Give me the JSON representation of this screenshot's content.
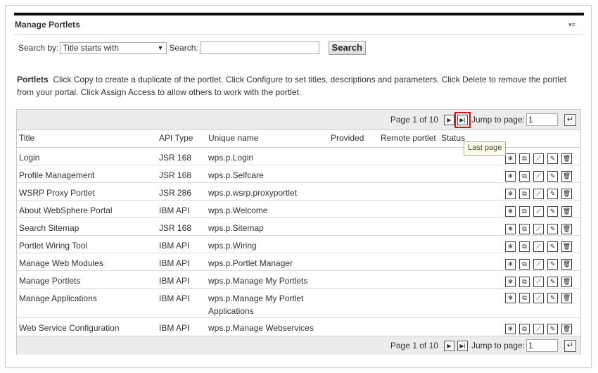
{
  "portlet": {
    "title": "Manage Portlets"
  },
  "search": {
    "by_label": "Search by:",
    "by_value": "Title starts with",
    "label": "Search:",
    "value": "",
    "button": "Search"
  },
  "description": {
    "heading": "Portlets",
    "text": "Click Copy to create a duplicate of the portlet. Click Configure to set titles, descriptions and parameters. Click Delete to remove the portlet from your portal. Click Assign Access to allow others to work with the portlet."
  },
  "pager": {
    "page_text": "Page 1 of 10",
    "jump_label": "Jump to page:",
    "jump_value": "1",
    "tooltip": "Last page"
  },
  "table": {
    "columns": [
      "Title",
      "API Type",
      "Unique name",
      "Provided",
      "Remote portlet",
      "Status"
    ],
    "rows": [
      {
        "title": "Login",
        "api": "JSR 168",
        "unique": "wps.p.Login",
        "unique2": ""
      },
      {
        "title": "Profile Management",
        "api": "JSR 168",
        "unique": "wps.p.Selfcare",
        "unique2": ""
      },
      {
        "title": "WSRP Proxy Portlet",
        "api": "JSR 286",
        "unique": "wps.p.wsrp.proxyportlet",
        "unique2": ""
      },
      {
        "title": "About WebSphere Portal",
        "api": "IBM API",
        "unique": "wps.p.Welcome",
        "unique2": ""
      },
      {
        "title": "Search Sitemap",
        "api": "JSR 168",
        "unique": "wps.p.Sitemap",
        "unique2": ""
      },
      {
        "title": "Portlet Wiring Tool",
        "api": "IBM API",
        "unique": "wps.p.Wiring",
        "unique2": ""
      },
      {
        "title": "Manage Web Modules",
        "api": "IBM API",
        "unique": "wps.p.Portlet Manager",
        "unique2": ""
      },
      {
        "title": "Manage Portlets",
        "api": "IBM API",
        "unique": "wps.p.Manage My Portlets",
        "unique2": ""
      },
      {
        "title": "Manage Applications",
        "api": "IBM API",
        "unique": "wps.p.Manage My Portlet",
        "unique2": "Applications"
      },
      {
        "title": "Web Service Configuration",
        "api": "IBM API",
        "unique": "wps.p.Manage Webservices",
        "unique2": ""
      }
    ]
  }
}
